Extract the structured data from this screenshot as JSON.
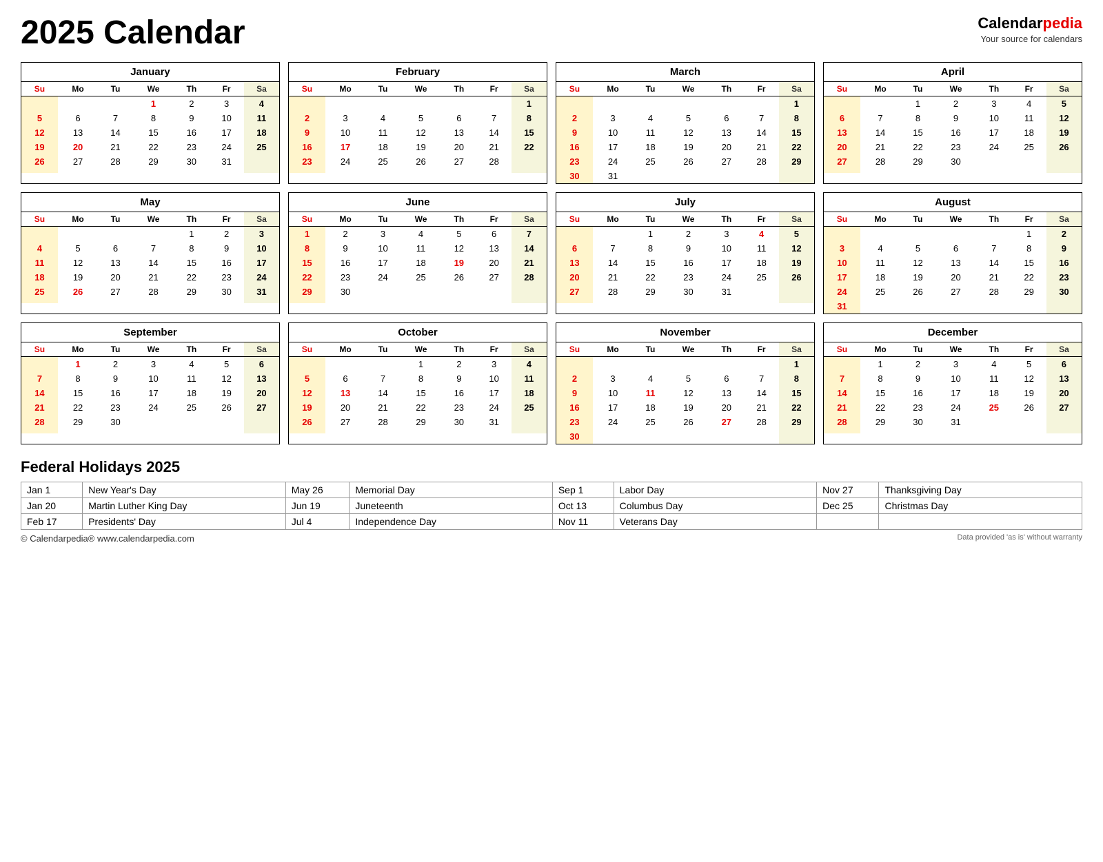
{
  "title": "2025 Calendar",
  "brand": {
    "name1": "Calendar",
    "name2": "pedia",
    "tagline": "Your source for calendars"
  },
  "months": [
    {
      "name": "January",
      "weeks": [
        [
          "",
          "",
          "",
          "1",
          "2",
          "3",
          "4"
        ],
        [
          "5",
          "6",
          "7",
          "8",
          "9",
          "10",
          "11"
        ],
        [
          "12",
          "13",
          "14",
          "15",
          "16",
          "17",
          "18"
        ],
        [
          "19",
          "20",
          "21",
          "22",
          "23",
          "24",
          "25"
        ],
        [
          "26",
          "27",
          "28",
          "29",
          "30",
          "31",
          ""
        ],
        [
          "",
          "",
          "",
          "",
          "",
          "",
          ""
        ]
      ],
      "redDays": [
        "1",
        "20"
      ],
      "hasExtraRow": true
    },
    {
      "name": "February",
      "weeks": [
        [
          "",
          "",
          "",
          "",
          "",
          "",
          "1"
        ],
        [
          "2",
          "3",
          "4",
          "5",
          "6",
          "7",
          "8"
        ],
        [
          "9",
          "10",
          "11",
          "12",
          "13",
          "14",
          "15"
        ],
        [
          "16",
          "17",
          "18",
          "19",
          "20",
          "21",
          "22"
        ],
        [
          "23",
          "24",
          "25",
          "26",
          "27",
          "28",
          ""
        ],
        [
          "",
          "",
          "",
          "",
          "",
          "",
          ""
        ]
      ],
      "redDays": [
        "17"
      ],
      "hasExtraRow": true
    },
    {
      "name": "March",
      "weeks": [
        [
          "",
          "",
          "",
          "",
          "",
          "",
          "1"
        ],
        [
          "2",
          "3",
          "4",
          "5",
          "6",
          "7",
          "8"
        ],
        [
          "9",
          "10",
          "11",
          "12",
          "13",
          "14",
          "15"
        ],
        [
          "16",
          "17",
          "18",
          "19",
          "20",
          "21",
          "22"
        ],
        [
          "23",
          "24",
          "25",
          "26",
          "27",
          "28",
          "29"
        ],
        [
          "30",
          "31",
          "",
          "",
          "",
          "",
          ""
        ]
      ],
      "redDays": [],
      "hasExtraRow": true
    },
    {
      "name": "April",
      "weeks": [
        [
          "",
          "",
          "1",
          "2",
          "3",
          "4",
          "5"
        ],
        [
          "6",
          "7",
          "8",
          "9",
          "10",
          "11",
          "12"
        ],
        [
          "13",
          "14",
          "15",
          "16",
          "17",
          "18",
          "19"
        ],
        [
          "20",
          "21",
          "22",
          "23",
          "24",
          "25",
          "26"
        ],
        [
          "27",
          "28",
          "29",
          "30",
          "",
          "",
          ""
        ],
        [
          "",
          "",
          "",
          "",
          "",
          "",
          ""
        ]
      ],
      "redDays": [],
      "hasExtraRow": true
    },
    {
      "name": "May",
      "weeks": [
        [
          "",
          "",
          "",
          "",
          "1",
          "2",
          "3"
        ],
        [
          "4",
          "5",
          "6",
          "7",
          "8",
          "9",
          "10"
        ],
        [
          "11",
          "12",
          "13",
          "14",
          "15",
          "16",
          "17"
        ],
        [
          "18",
          "19",
          "20",
          "21",
          "22",
          "23",
          "24"
        ],
        [
          "25",
          "26",
          "27",
          "28",
          "29",
          "30",
          "31"
        ],
        [
          "",
          "",
          "",
          "",
          "",
          "",
          ""
        ]
      ],
      "redDays": [
        "26"
      ],
      "hasExtraRow": true
    },
    {
      "name": "June",
      "weeks": [
        [
          "1",
          "2",
          "3",
          "4",
          "5",
          "6",
          "7"
        ],
        [
          "8",
          "9",
          "10",
          "11",
          "12",
          "13",
          "14"
        ],
        [
          "15",
          "16",
          "17",
          "18",
          "19",
          "20",
          "21"
        ],
        [
          "22",
          "23",
          "24",
          "25",
          "26",
          "27",
          "28"
        ],
        [
          "29",
          "30",
          "",
          "",
          "",
          "",
          ""
        ],
        [
          "",
          "",
          "",
          "",
          "",
          "",
          ""
        ]
      ],
      "redDays": [
        "19"
      ],
      "hasExtraRow": true
    },
    {
      "name": "July",
      "weeks": [
        [
          "",
          "",
          "1",
          "2",
          "3",
          "4",
          "5"
        ],
        [
          "6",
          "7",
          "8",
          "9",
          "10",
          "11",
          "12"
        ],
        [
          "13",
          "14",
          "15",
          "16",
          "17",
          "18",
          "19"
        ],
        [
          "20",
          "21",
          "22",
          "23",
          "24",
          "25",
          "26"
        ],
        [
          "27",
          "28",
          "29",
          "30",
          "31",
          "",
          ""
        ],
        [
          "",
          "",
          "",
          "",
          "",
          "",
          ""
        ]
      ],
      "redDays": [
        "4"
      ],
      "hasExtraRow": true
    },
    {
      "name": "August",
      "weeks": [
        [
          "",
          "",
          "",
          "",
          "",
          "1",
          "2"
        ],
        [
          "3",
          "4",
          "5",
          "6",
          "7",
          "8",
          "9"
        ],
        [
          "10",
          "11",
          "12",
          "13",
          "14",
          "15",
          "16"
        ],
        [
          "17",
          "18",
          "19",
          "20",
          "21",
          "22",
          "23"
        ],
        [
          "24",
          "25",
          "26",
          "27",
          "28",
          "29",
          "30"
        ],
        [
          "31",
          "",
          "",
          "",
          "",
          "",
          ""
        ]
      ],
      "redDays": [],
      "hasExtraRow": true
    },
    {
      "name": "September",
      "weeks": [
        [
          "",
          "1",
          "2",
          "3",
          "4",
          "5",
          "6"
        ],
        [
          "7",
          "8",
          "9",
          "10",
          "11",
          "12",
          "13"
        ],
        [
          "14",
          "15",
          "16",
          "17",
          "18",
          "19",
          "20"
        ],
        [
          "21",
          "22",
          "23",
          "24",
          "25",
          "26",
          "27"
        ],
        [
          "28",
          "29",
          "30",
          "",
          "",
          "",
          ""
        ],
        [
          "",
          "",
          "",
          "",
          "",
          "",
          ""
        ]
      ],
      "redDays": [
        "1"
      ],
      "hasExtraRow": true
    },
    {
      "name": "October",
      "weeks": [
        [
          "",
          "",
          "",
          "1",
          "2",
          "3",
          "4"
        ],
        [
          "5",
          "6",
          "7",
          "8",
          "9",
          "10",
          "11"
        ],
        [
          "12",
          "13",
          "14",
          "15",
          "16",
          "17",
          "18"
        ],
        [
          "19",
          "20",
          "21",
          "22",
          "23",
          "24",
          "25"
        ],
        [
          "26",
          "27",
          "28",
          "29",
          "30",
          "31",
          ""
        ],
        [
          "",
          "",
          "",
          "",
          "",
          "",
          ""
        ]
      ],
      "redDays": [
        "13"
      ],
      "hasExtraRow": true
    },
    {
      "name": "November",
      "weeks": [
        [
          "",
          "",
          "",
          "",
          "",
          "",
          "1"
        ],
        [
          "2",
          "3",
          "4",
          "5",
          "6",
          "7",
          "8"
        ],
        [
          "9",
          "10",
          "11",
          "12",
          "13",
          "14",
          "15"
        ],
        [
          "16",
          "17",
          "18",
          "19",
          "20",
          "21",
          "22"
        ],
        [
          "23",
          "24",
          "25",
          "26",
          "27",
          "28",
          "29"
        ],
        [
          "30",
          "",
          "",
          "",
          "",
          "",
          ""
        ]
      ],
      "redDays": [
        "11",
        "27"
      ],
      "hasExtraRow": true
    },
    {
      "name": "December",
      "weeks": [
        [
          "",
          "1",
          "2",
          "3",
          "4",
          "5",
          "6"
        ],
        [
          "7",
          "8",
          "9",
          "10",
          "11",
          "12",
          "13"
        ],
        [
          "14",
          "15",
          "16",
          "17",
          "18",
          "19",
          "20"
        ],
        [
          "21",
          "22",
          "23",
          "24",
          "25",
          "26",
          "27"
        ],
        [
          "28",
          "29",
          "30",
          "31",
          "",
          "",
          ""
        ],
        [
          "",
          "",
          "",
          "",
          "",
          "",
          ""
        ]
      ],
      "redDays": [
        "25"
      ],
      "hasExtraRow": true
    }
  ],
  "dayHeaders": [
    "Su",
    "Mo",
    "Tu",
    "We",
    "Th",
    "Fr",
    "Sa"
  ],
  "holidays": {
    "title": "Federal Holidays 2025",
    "col1": [
      {
        "date": "Jan 1",
        "name": "New Year's Day"
      },
      {
        "date": "Jan 20",
        "name": "Martin Luther King Day"
      },
      {
        "date": "Feb 17",
        "name": "Presidents' Day"
      }
    ],
    "col2": [
      {
        "date": "May 26",
        "name": "Memorial Day"
      },
      {
        "date": "Jun 19",
        "name": "Juneteenth"
      },
      {
        "date": "Jul 4",
        "name": "Independence Day"
      }
    ],
    "col3": [
      {
        "date": "Sep 1",
        "name": "Labor Day"
      },
      {
        "date": "Oct 13",
        "name": "Columbus Day"
      },
      {
        "date": "Nov 11",
        "name": "Veterans Day"
      }
    ],
    "col4": [
      {
        "date": "Nov 27",
        "name": "Thanksgiving Day"
      },
      {
        "date": "Dec 25",
        "name": "Christmas Day"
      }
    ]
  },
  "footer": {
    "copyright": "© Calendarpedia®  www.calendarpedia.com",
    "disclaimer": "Data provided 'as is' without warranty"
  }
}
